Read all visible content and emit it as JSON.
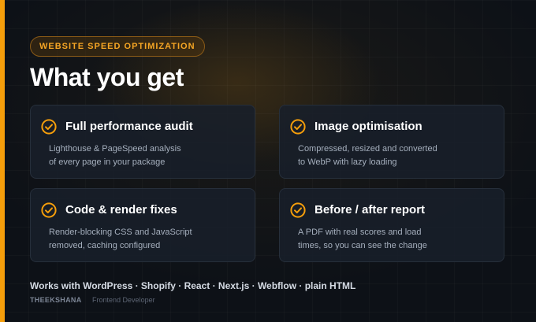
{
  "badge": "WEBSITE SPEED OPTIMIZATION",
  "title": "What you get",
  "colors": {
    "accent": "#f59e0b",
    "background": "#0d1117",
    "card": "#181f2a"
  },
  "cards": [
    {
      "icon": "check-circle-icon",
      "title": "Full performance audit",
      "desc": [
        "Lighthouse & PageSpeed analysis",
        "of every page in your package"
      ]
    },
    {
      "icon": "check-circle-icon",
      "title": "Image optimisation",
      "desc": [
        "Compressed, resized and converted",
        "to WebP with lazy loading"
      ]
    },
    {
      "icon": "check-circle-icon",
      "title": "Code & render fixes",
      "desc": [
        "Render-blocking CSS and JavaScript",
        "removed, caching configured"
      ]
    },
    {
      "icon": "check-circle-icon",
      "title": "Before / after report",
      "desc": [
        "A PDF with real scores and load",
        "times, so you can see the change"
      ]
    }
  ],
  "platforms": "Works with WordPress · Shopify · React · Next.js · Webflow · plain HTML",
  "author": {
    "name": "THEEKSHANA",
    "role": "Frontend Developer"
  }
}
